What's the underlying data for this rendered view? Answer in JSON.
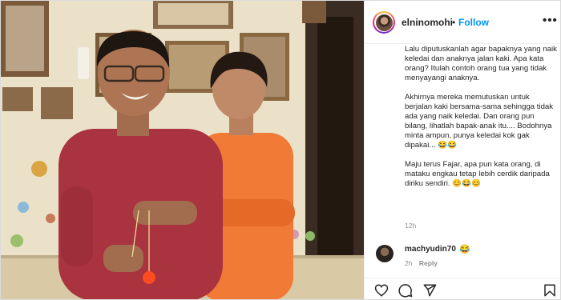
{
  "post": {
    "username": "elninomohi",
    "separator": "•",
    "follow_label": "Follow",
    "more_label": "•••",
    "caption_paragraphs": [
      "Lalu diputuskanlah agar bapaknya yang naik keledai dan anaknya jalan kaki. Apa kata orang? Itulah contoh orang tua yang tidak menyayangi anaknya.",
      "Akhirnya mereka memutuskan untuk berjalan kaki bersama-sama sehingga tidak ada yang naik keledai. Dan orang pun bilang, lihatlah bapak-anak itu.... Bodohnya minta ampun, punya keledai kok gak dipakai... 😂😂",
      "Maju terus Fajar, apa pun kata orang, di mataku engkau tetap lebih cerdik daripada diriku sendiri. 😊😂😊"
    ],
    "time_ago": "12h"
  },
  "comment": {
    "username": "machyudin70",
    "text": "😂",
    "time_ago": "2h",
    "reply_label": "Reply"
  },
  "actions": {
    "icons": [
      "heart-icon",
      "comment-icon",
      "share-icon",
      "bookmark-icon"
    ]
  },
  "colors": {
    "accent": "#0095f6",
    "text": "#262626",
    "muted": "#8e8e8e",
    "border": "#dbdbdb"
  }
}
